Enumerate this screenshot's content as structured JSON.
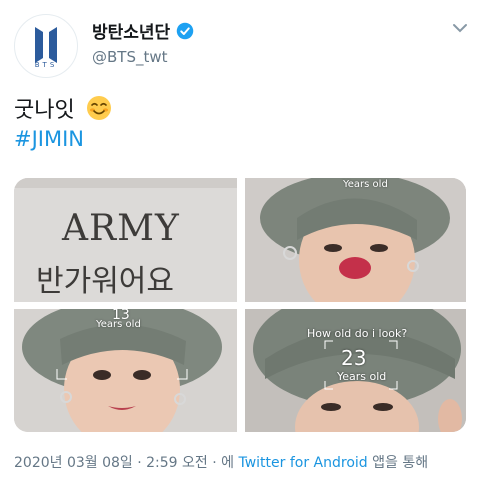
{
  "header": {
    "display_name": "방탄소년단",
    "handle": "@BTS_twt",
    "avatar_logo_text": "BTS"
  },
  "tweet": {
    "text": "굿나잇",
    "emoji": "smiling-face-with-smiling-eyes",
    "hashtag": "#JIMIN"
  },
  "media": {
    "tile1": {
      "line1": "ARMY",
      "line2": "반가워어요"
    },
    "tile2": {
      "label": "Years old"
    },
    "tile3": {
      "age": "13",
      "label": "Years old"
    },
    "tile4": {
      "question": "How old do i look?",
      "age": "23",
      "label": "Years old"
    }
  },
  "timestamp": {
    "date_time": "2020년 03월 08일 · 2:59 오전 · 에",
    "source": "Twitter for Android",
    "suffix": "앱을 통해"
  },
  "colors": {
    "accent": "#1b95e0",
    "secondary_text": "#657786",
    "logo_blue": "#2c5b9c"
  }
}
